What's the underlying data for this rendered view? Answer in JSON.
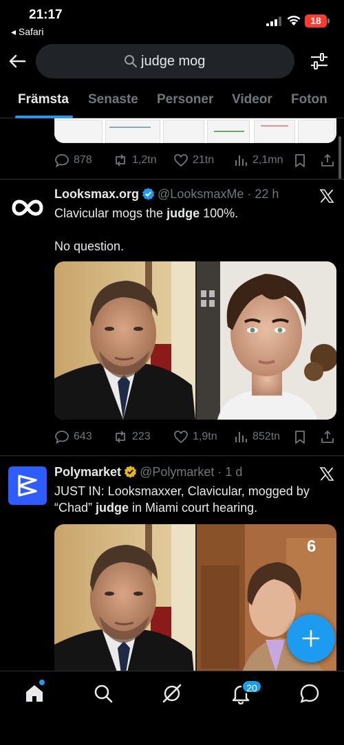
{
  "status_bar": {
    "time": "21:17",
    "back_app": "◂ Safari",
    "battery": "18"
  },
  "search": {
    "query": "judge mog"
  },
  "tabs": [
    {
      "label": "Främsta",
      "active": true
    },
    {
      "label": "Senaste"
    },
    {
      "label": "Personer"
    },
    {
      "label": "Videor"
    },
    {
      "label": "Foton"
    }
  ],
  "prev_tweet": {
    "replies": "878",
    "reposts": "1,2tn",
    "likes": "21tn",
    "views": "2,1mn"
  },
  "tweets": [
    {
      "name": "Looksmax.org",
      "handle": "@LooksmaxMe",
      "sep": "·",
      "time": "22 h",
      "text_a": "Clavicular mogs the ",
      "text_bold": "judge",
      "text_b": " 100%.",
      "text_line2": "No question.",
      "replies": "643",
      "reposts": "223",
      "likes": "1,9tn",
      "views": "852tn"
    },
    {
      "name": "Polymarket",
      "handle": "@Polymarket",
      "sep": "·",
      "time": "1 d",
      "text_a": "JUST IN: Looksmaxxer, Clavicular, mogged by “Chad” ",
      "text_bold": "judge",
      "text_b": " in Miami court hearing.",
      "watermark": "6"
    }
  ],
  "nav": {
    "notifications_badge": "20"
  },
  "colors": {
    "accent": "#1d9bf0",
    "muted": "#71767b",
    "gold": "#e2b719"
  }
}
